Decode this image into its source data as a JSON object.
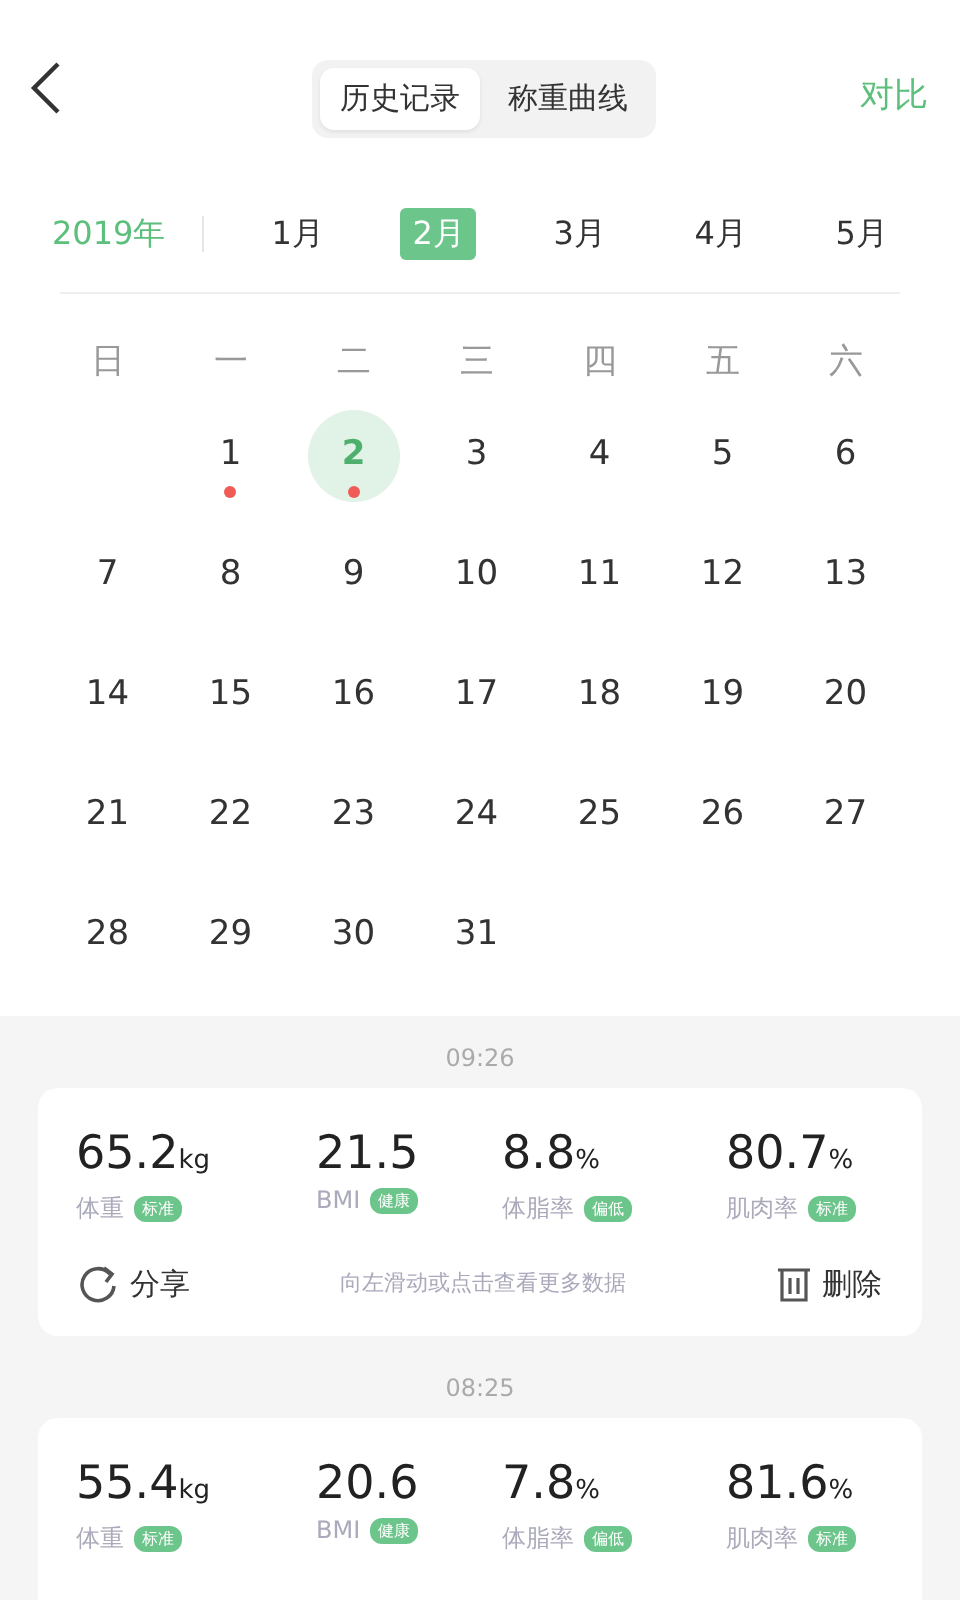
{
  "header": {
    "tabs": [
      {
        "label": "历史记录",
        "selected": true
      },
      {
        "label": "称重曲线",
        "selected": false
      }
    ],
    "compare": "对比"
  },
  "months": {
    "year": "2019年",
    "items": [
      {
        "label": "1月",
        "selected": false
      },
      {
        "label": "2月",
        "selected": true
      },
      {
        "label": "3月",
        "selected": false
      },
      {
        "label": "4月",
        "selected": false
      },
      {
        "label": "5月",
        "selected": false
      }
    ]
  },
  "calendar": {
    "weekdays": [
      "日",
      "一",
      "二",
      "三",
      "四",
      "五",
      "六"
    ],
    "weeks": [
      {
        "days": [
          {
            "day": "1",
            "selected": false,
            "has_record": true
          },
          {
            "day": "2",
            "selected": true,
            "has_record": true
          },
          {
            "day": "3",
            "selected": false,
            "has_record": false
          },
          {
            "day": "4",
            "selected": false,
            "has_record": false
          },
          {
            "day": "5",
            "selected": false,
            "has_record": false
          },
          {
            "day": "6",
            "selected": false,
            "has_record": false
          }
        ]
      },
      {
        "days": [
          {
            "day": "7",
            "selected": false,
            "has_record": false
          },
          {
            "day": "8",
            "selected": false,
            "has_record": false
          },
          {
            "day": "9",
            "selected": false,
            "has_record": false
          },
          {
            "day": "10",
            "selected": false,
            "has_record": false
          },
          {
            "day": "11",
            "selected": false,
            "has_record": false
          },
          {
            "day": "12",
            "selected": false,
            "has_record": false
          },
          {
            "day": "13",
            "selected": false,
            "has_record": false
          }
        ]
      },
      {
        "days": [
          {
            "day": "14",
            "selected": false,
            "has_record": false
          },
          {
            "day": "15",
            "selected": false,
            "has_record": false
          },
          {
            "day": "16",
            "selected": false,
            "has_record": false
          },
          {
            "day": "17",
            "selected": false,
            "has_record": false
          },
          {
            "day": "18",
            "selected": false,
            "has_record": false
          },
          {
            "day": "19",
            "selected": false,
            "has_record": false
          },
          {
            "day": "20",
            "selected": false,
            "has_record": false
          }
        ]
      },
      {
        "days": [
          {
            "day": "21",
            "selected": false,
            "has_record": false
          },
          {
            "day": "22",
            "selected": false,
            "has_record": false
          },
          {
            "day": "23",
            "selected": false,
            "has_record": false
          },
          {
            "day": "24",
            "selected": false,
            "has_record": false
          },
          {
            "day": "25",
            "selected": false,
            "has_record": false
          },
          {
            "day": "26",
            "selected": false,
            "has_record": false
          },
          {
            "day": "27",
            "selected": false,
            "has_record": false
          }
        ]
      },
      {
        "days": [
          {
            "day": "28",
            "selected": false,
            "has_record": false
          },
          {
            "day": "29",
            "selected": false,
            "has_record": false
          },
          {
            "day": "30",
            "selected": false,
            "has_record": false
          },
          {
            "day": "31",
            "selected": false,
            "has_record": false
          }
        ]
      }
    ]
  },
  "records": [
    {
      "time": "09:26",
      "metrics": [
        {
          "value": "65.2",
          "unit": "kg",
          "label": "体重",
          "tag": "标准"
        },
        {
          "value": "21.5",
          "label": "BMI",
          "tag": "健康"
        },
        {
          "value": "8.8",
          "unit": "%",
          "label": "体脂率",
          "tag": "偏低"
        },
        {
          "value": "80.7",
          "unit": "%",
          "label": "肌肉率",
          "tag": "标准"
        }
      ],
      "actions": {
        "share": "分享",
        "hint": "向左滑动或点击查看更多数据",
        "delete": "删除"
      }
    },
    {
      "time": "08:25",
      "metrics": [
        {
          "value": "55.4",
          "unit": "kg",
          "label": "体重",
          "tag": "标准"
        },
        {
          "value": "20.6",
          "label": "BMI",
          "tag": "健康"
        },
        {
          "value": "7.8",
          "unit": "%",
          "label": "体脂率",
          "tag": "偏低"
        },
        {
          "value": "81.6",
          "unit": "%",
          "label": "肌肉率",
          "tag": "标准"
        }
      ]
    }
  ]
}
